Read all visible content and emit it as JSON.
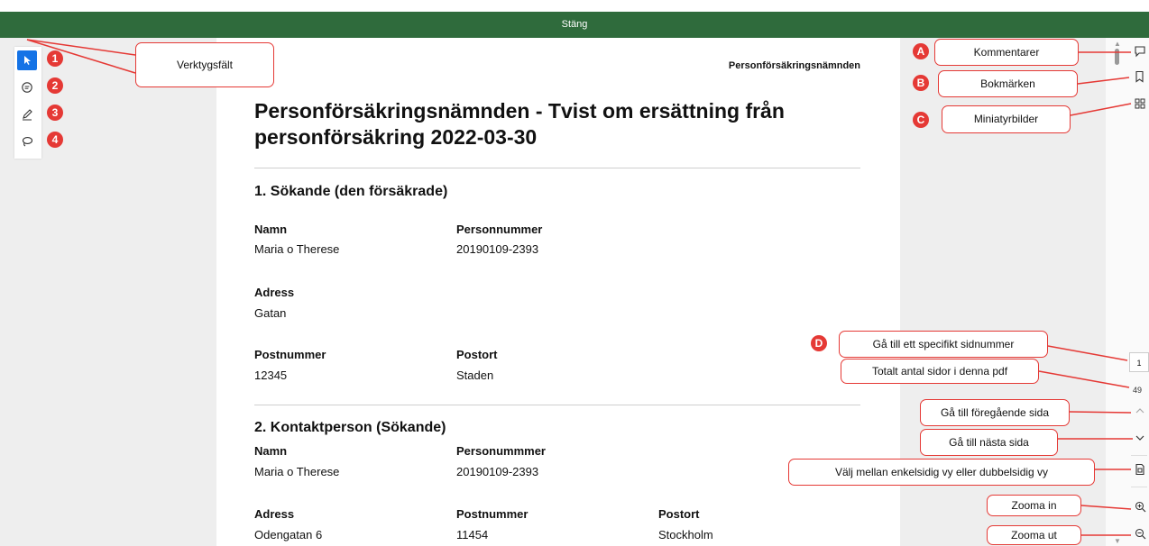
{
  "topbar": {
    "close_label": "Stäng"
  },
  "toolbar": {
    "tools": [
      {
        "icon": "pointer-icon",
        "badge": "1"
      },
      {
        "icon": "comment-icon",
        "badge": "2"
      },
      {
        "icon": "pen-icon",
        "badge": "3"
      },
      {
        "icon": "lasso-icon",
        "badge": "4"
      }
    ]
  },
  "callouts": {
    "toolbar": "Verktygsfält",
    "comments": "Kommentarer",
    "bookmarks": "Bokmärken",
    "thumbnails": "Miniatyrbilder",
    "goto_page": "Gå till ett specifikt sidnummer",
    "total_pages": "Totalt antal sidor i denna pdf",
    "prev_page": "Gå till föregående sida",
    "next_page": "Gå till nästa sida",
    "view_mode": "Välj mellan enkelsidig vy eller dubbelsidig vy",
    "zoom_in": "Zooma in",
    "zoom_out": "Zooma ut"
  },
  "letter_badges": {
    "a": "A",
    "b": "B",
    "c": "C",
    "d": "D"
  },
  "document": {
    "header": "Personförsäkringsnämnden",
    "title": "Personförsäkringsnämnden - Tvist om ersättning från personförsäkring 2022-03-30",
    "section1": {
      "heading": "1. Sökande (den försäkrade)",
      "name_label": "Namn",
      "name_value": "Maria o Therese",
      "pnr_label": "Personnummer",
      "pnr_value": "20190109-2393",
      "address_label": "Adress",
      "address_value": "Gatan",
      "postnr_label": "Postnummer",
      "postnr_value": "12345",
      "postort_label": "Postort",
      "postort_value": "Staden"
    },
    "section2": {
      "heading": "2. Kontaktperson (Sökande)",
      "name_label": "Namn",
      "name_value": "Maria o Therese",
      "pnr_label": "Personummmer",
      "pnr_value": "20190109-2393",
      "address_label": "Adress",
      "address_value": "Odengatan 6",
      "postnr_label": "Postnummer",
      "postnr_value": "11454",
      "postort_label": "Postort",
      "postort_value": "Stockholm"
    }
  },
  "navigation": {
    "current_page": "1",
    "total_pages": "49"
  },
  "colors": {
    "topbar": "#2f6b3c",
    "accent": "#1473e6",
    "annotation": "#e53935"
  }
}
